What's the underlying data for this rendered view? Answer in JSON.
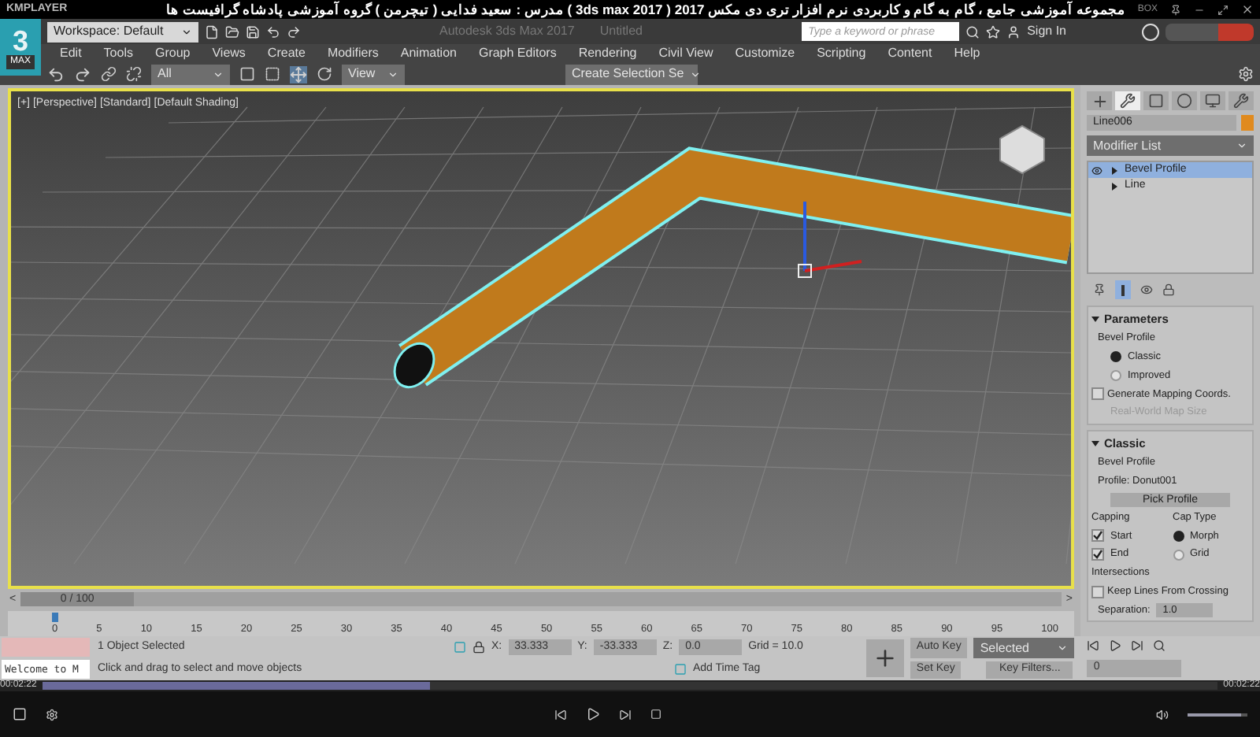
{
  "player": {
    "logo": "KMPLAYER",
    "title": "مجموعه آموزشی جامع ، گام به گام و کاربردی نرم افزار تری دی مکس 2017 ( 3ds max 2017 ) مدرس : سعید فدایی ( تیچرمن ) گروه آموزشی پادشاه گرافیست ها",
    "badge": "BOX",
    "elapsed": "00:02:22",
    "total": "00:02:22",
    "progress": {
      "level": 0.33
    },
    "volume": {
      "level": 0.9
    }
  },
  "app": {
    "logo": "3",
    "logo_sub": "MAX",
    "workspace": "Workspace: Default",
    "title": "Autodesk 3ds Max 2017",
    "document": "Untitled",
    "search": {
      "placeholder": "Type a keyword or phrase"
    },
    "sign_in": "Sign In"
  },
  "menu": [
    "Edit",
    "Tools",
    "Group",
    "Views",
    "Create",
    "Modifiers",
    "Animation",
    "Graph Editors",
    "Rendering",
    "Civil View",
    "Customize",
    "Scripting",
    "Content",
    "Help"
  ],
  "toolbar": {
    "selection_filter": "All",
    "reference": "View",
    "selection_set": "Create Selection Se"
  },
  "viewport": {
    "labels": [
      "[+]",
      "[Perspective]",
      "[Standard]",
      "[Default Shading]"
    ]
  },
  "command_panel": {
    "tabs": [
      {
        "kind": "create",
        "selected": false
      },
      {
        "kind": "modify",
        "selected": true
      },
      {
        "kind": "hierarchy",
        "selected": false
      },
      {
        "kind": "motion",
        "selected": false
      },
      {
        "kind": "display",
        "selected": false
      },
      {
        "kind": "utilities",
        "selected": false
      }
    ],
    "object_name": "Line006",
    "modifier_list": "Modifier List",
    "stack": [
      {
        "label": "Bevel Profile",
        "selected": true
      },
      {
        "label": "Line",
        "selected": false
      }
    ],
    "parameters": {
      "title": "Parameters",
      "expanded": true,
      "group": "Bevel Profile",
      "options": [
        {
          "label": "Classic",
          "selected": true
        },
        {
          "label": "Improved",
          "selected": false
        }
      ],
      "mapping": {
        "label": "Generate Mapping Coords.",
        "checked": false
      },
      "real_world": {
        "label": "Real-World Map Size",
        "disabled": true
      }
    },
    "classic": {
      "title": "Classic",
      "expanded": true,
      "group": "Bevel Profile",
      "profile": "Profile: Donut001",
      "pick": "Pick Profile",
      "capping": {
        "title": "Capping",
        "items": [
          {
            "label": "Start",
            "checked": true
          },
          {
            "label": "End",
            "checked": true
          }
        ]
      },
      "cap_type": {
        "title": "Cap Type",
        "items": [
          {
            "label": "Morph",
            "selected": true
          },
          {
            "label": "Grid",
            "selected": false
          }
        ]
      },
      "intersections": "Intersections",
      "keep": {
        "label": "Keep Lines From Crossing",
        "checked": false
      },
      "separation": {
        "label": "Separation:",
        "value": "1.0"
      }
    }
  },
  "timeline": {
    "position": "0 / 100",
    "level": 0,
    "prev": "<",
    "next": ">",
    "ticks": [
      "0",
      "5",
      "10",
      "15",
      "20",
      "25",
      "30",
      "35",
      "40",
      "45",
      "50",
      "55",
      "60",
      "65",
      "70",
      "75",
      "80",
      "85",
      "90",
      "95",
      "100"
    ]
  },
  "status": {
    "selection": "1 Object Selected",
    "prompt": "Click and drag to select and move objects",
    "script": "Welcome to M",
    "x": {
      "label": "X:",
      "value": "33.333"
    },
    "y": {
      "label": "Y:",
      "value": "-33.333"
    },
    "z": {
      "label": "Z:",
      "value": "0.0"
    },
    "grid": "Grid = 10.0",
    "time_tag": "Add Time Tag",
    "auto_key": "Auto Key",
    "key_mode": "Selected",
    "set_key": "Set Key",
    "key_filters": "Key Filters...",
    "frame": "0"
  }
}
